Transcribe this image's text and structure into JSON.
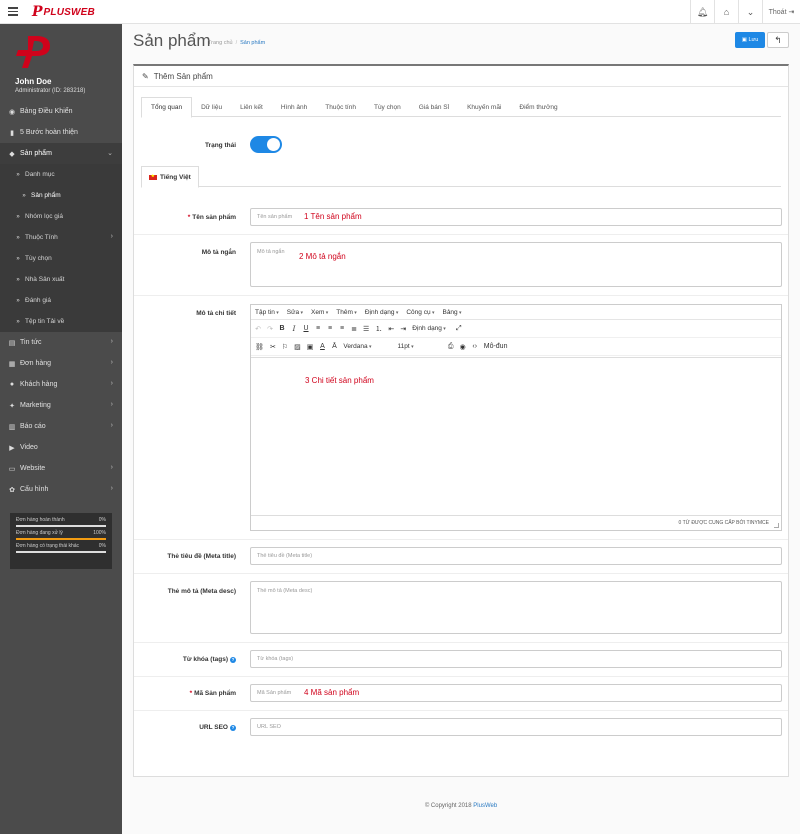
{
  "topbar": {
    "logo_mark": "P",
    "logo_text": "PLUSWEB",
    "logout_label": "Thoát"
  },
  "user": {
    "name": "John Doe",
    "role": "Administrator (ID: 283218)"
  },
  "sidebar": {
    "items": [
      {
        "icon": "dashboard-icon",
        "glyph": "◉",
        "label": "Bảng Điều Khiển"
      },
      {
        "icon": "book-icon",
        "glyph": "▮",
        "label": "5 Bước hoàn thiện"
      },
      {
        "icon": "tag-icon",
        "glyph": "◆",
        "label": "Sản phẩm"
      }
    ],
    "sub_items": [
      {
        "label": "Danh mục"
      },
      {
        "label": "Sản phẩm"
      },
      {
        "label": "Nhóm lọc giá"
      },
      {
        "label": "Thuộc Tính"
      },
      {
        "label": "Tùy chọn"
      },
      {
        "label": "Nhà Sản xuất"
      },
      {
        "label": "Đánh giá"
      },
      {
        "label": "Tệp tin Tải về"
      }
    ],
    "items_after": [
      {
        "glyph": "▤",
        "label": "Tin tức"
      },
      {
        "glyph": "▦",
        "label": "Đơn hàng"
      },
      {
        "glyph": "●",
        "label": "Khách hàng"
      },
      {
        "glyph": "✦",
        "label": "Marketing"
      },
      {
        "glyph": "▥",
        "label": "Báo cáo"
      },
      {
        "glyph": "▶",
        "label": "Video"
      },
      {
        "glyph": "▭",
        "label": "Website"
      },
      {
        "glyph": "✿",
        "label": "Cấu hình"
      }
    ],
    "stats": [
      {
        "label": "Đơn hàng hoàn thành",
        "value": "0%",
        "fraction": 0
      },
      {
        "label": "Đơn hàng đang xử lý",
        "value": "100%",
        "fraction": 1
      },
      {
        "label": "Đơn hàng có trạng thái khác",
        "value": "0%",
        "fraction": 0
      }
    ]
  },
  "header": {
    "title": "Sản phẩm",
    "breadcrumb_home": "Trang chủ",
    "breadcrumb_current": "Sản phẩm",
    "save_label": "Lưu"
  },
  "panel": {
    "title": "Thêm Sản phẩm",
    "tabs": [
      "Tổng quan",
      "Dữ liệu",
      "Liên kết",
      "Hình ảnh",
      "Thuộc tính",
      "Tùy chọn",
      "Giá bán Sỉ",
      "Khuyến mãi",
      "Điểm thưởng"
    ],
    "status_label": "Trạng thái",
    "lang_tab": "Tiếng Việt"
  },
  "form": {
    "name_label": "Tên sản phẩm",
    "name_placeholder": "Tên sản phẩm",
    "name_annotation": "1 Tên sản phẩm",
    "short_label": "Mô tả ngắn",
    "short_placeholder": "Mô tả ngắn",
    "short_annotation": "2 Mô tả ngắn",
    "detail_label": "Mô tả chi tiết",
    "detail_annotation": "3 Chi tiết sản phẩm",
    "meta_title_label": "Thẻ tiêu đề (Meta title)",
    "meta_title_placeholder": "Thẻ tiêu đề (Meta title)",
    "meta_desc_label": "Thẻ mô tả (Meta desc)",
    "meta_desc_placeholder": "Thẻ mô tả (Meta desc)",
    "tags_label": "Từ khóa (tags)",
    "tags_placeholder": "Từ khóa (tags)",
    "code_label": "Mã Sản phẩm",
    "code_placeholder": "Mã Sản phẩm",
    "code_annotation": "4 Mã sản phẩm",
    "seo_label": "URL SEO",
    "seo_placeholder": "URL SEO"
  },
  "editor": {
    "menus": [
      "Tập tin",
      "Sửa",
      "Xem",
      "Thêm",
      "Định dạng",
      "Công cụ",
      "Bảng"
    ],
    "format_dropdown": "Định dạng",
    "font_family": "Verdana",
    "font_size": "11pt",
    "modun_label": "Mô-đun",
    "powered_by": "0 TỪ ĐƯỢC CUNG CẤP BỞI TINYMCE"
  },
  "footer": {
    "copyright": "© Copyright 2018",
    "brand": "PlusWeb"
  }
}
